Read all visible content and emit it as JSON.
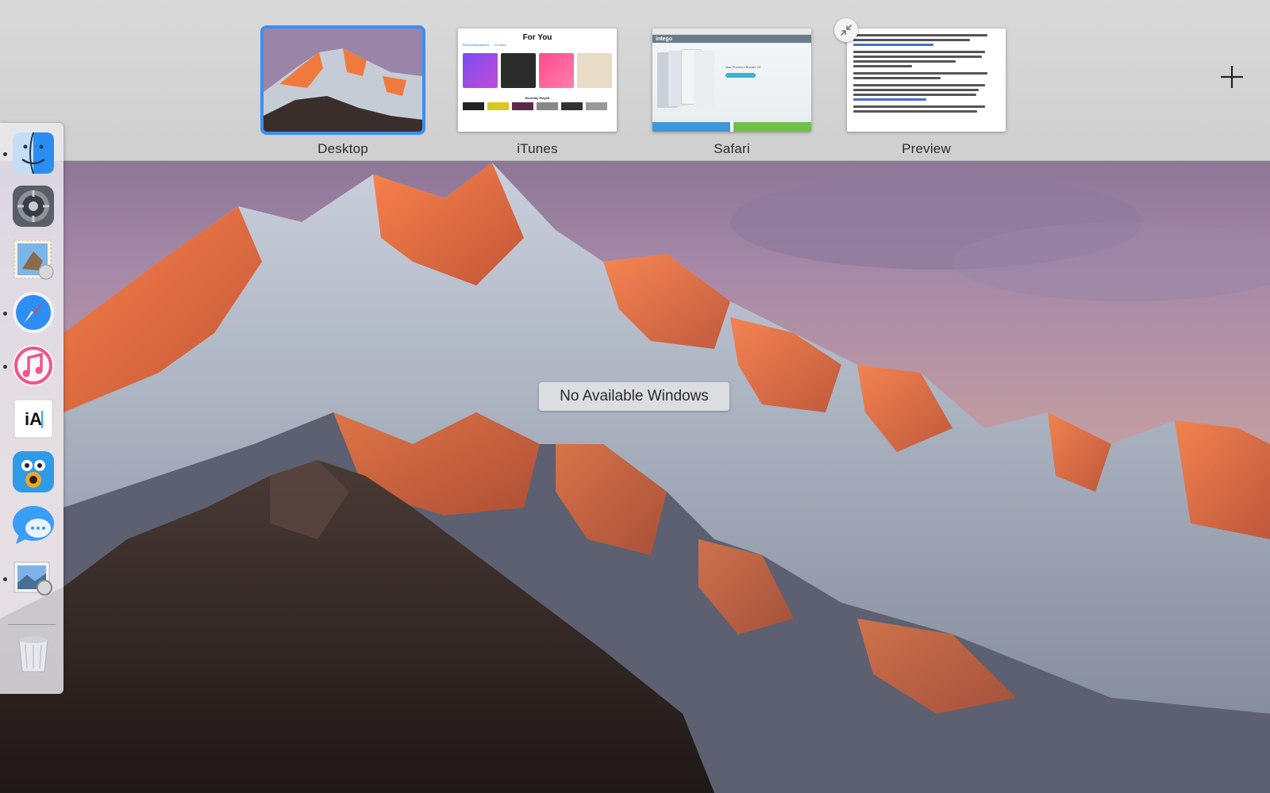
{
  "spaces": [
    {
      "id": "desktop",
      "label": "Desktop",
      "active": true
    },
    {
      "id": "itunes",
      "label": "iTunes",
      "active": false
    },
    {
      "id": "safari",
      "label": "Safari",
      "active": false
    },
    {
      "id": "preview",
      "label": "Preview",
      "active": false
    }
  ],
  "itunes_thumb": {
    "title": "For You",
    "tabs": [
      "Recommendations",
      "Connect"
    ],
    "tile1": "My Favorites Mix",
    "tile2": "My New Music Mix",
    "recent": "Recently Played"
  },
  "safari_thumb": {
    "brand": "intego",
    "product": "Mac Premium Bundle X9"
  },
  "message": "No Available Windows",
  "dock": {
    "apps": [
      {
        "name": "Finder",
        "icon": "finder-icon",
        "running": true
      },
      {
        "name": "System Preferences",
        "icon": "system-preferences-icon",
        "running": false
      },
      {
        "name": "Mail",
        "icon": "mail-icon",
        "running": false
      },
      {
        "name": "Safari",
        "icon": "safari-icon",
        "running": true
      },
      {
        "name": "iTunes",
        "icon": "itunes-icon",
        "running": true
      },
      {
        "name": "iA Writer",
        "icon": "ia-writer-icon",
        "running": false
      },
      {
        "name": "Tweetbot",
        "icon": "tweetbot-icon",
        "running": false
      },
      {
        "name": "Messages",
        "icon": "messages-icon",
        "running": false
      },
      {
        "name": "Preview",
        "icon": "preview-icon",
        "running": true
      },
      {
        "name": "Trash",
        "icon": "trash-icon",
        "running": false
      }
    ],
    "ia_writer_text": "iA"
  },
  "colors": {
    "accent": "#3b8ff0",
    "spaces_bar": "#d6d6d6"
  }
}
